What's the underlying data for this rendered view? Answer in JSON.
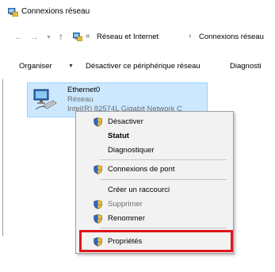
{
  "window": {
    "title": "Connexions réseau"
  },
  "address": {
    "lead": "«",
    "crumb_1": "Réseau et Internet",
    "separator": "›",
    "crumb_2": "Connexions réseau"
  },
  "toolbar": {
    "organise": "Organiser",
    "disable_device": "Désactiver ce périphérique réseau",
    "diagnose": "Diagnosti"
  },
  "network_item": {
    "name": "Ethernet0",
    "status": "Réseau",
    "adapter": "Intel(R) 82574L Gigabit Network C"
  },
  "context_menu": {
    "items": [
      {
        "label": "Désactiver",
        "shield": true,
        "bold": false,
        "disabled": false
      },
      {
        "label": "Statut",
        "shield": false,
        "bold": true,
        "disabled": false
      },
      {
        "label": "Diagnostiquer",
        "shield": false,
        "bold": false,
        "disabled": false
      },
      {
        "label": "Connexions de pont",
        "shield": true,
        "bold": false,
        "disabled": false
      },
      {
        "label": "Créer un raccourci",
        "shield": false,
        "bold": false,
        "disabled": false
      },
      {
        "label": "Supprimer",
        "shield": true,
        "bold": false,
        "disabled": true
      },
      {
        "label": "Renommer",
        "shield": true,
        "bold": false,
        "disabled": false
      },
      {
        "label": "Propriétés",
        "shield": true,
        "bold": false,
        "disabled": false
      }
    ]
  },
  "colors": {
    "selection_bg": "#cce8ff",
    "selection_border": "#99d1ff",
    "highlight": "#e0151d",
    "menu_bg": "#f2f2f2"
  }
}
